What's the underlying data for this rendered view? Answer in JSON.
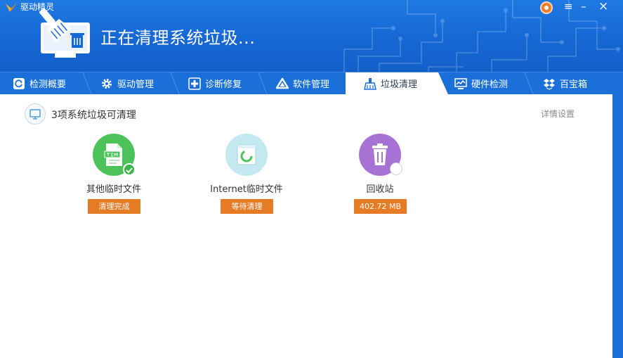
{
  "app": {
    "title": "驱动精灵",
    "status_text": "正在清理系统垃圾..."
  },
  "window_controls": {
    "menu": "≡",
    "minimize": "–",
    "close": "×"
  },
  "tabs": [
    {
      "label": "检测概要",
      "icon": "refresh-icon",
      "active": false
    },
    {
      "label": "驱动管理",
      "icon": "gear-icon",
      "active": false
    },
    {
      "label": "诊断修复",
      "icon": "medical-cross-icon",
      "active": false
    },
    {
      "label": "软件管理",
      "icon": "triangle-logo-icon",
      "active": false
    },
    {
      "label": "垃圾清理",
      "icon": "broom-icon",
      "active": true
    },
    {
      "label": "硬件检测",
      "icon": "monitor-chart-icon",
      "active": false
    },
    {
      "label": "百宝箱",
      "icon": "dropbox-icon",
      "active": false
    }
  ],
  "cleanup": {
    "summary": "3项系统垃圾可清理",
    "settings_link": "详情设置",
    "items": [
      {
        "label": "其他临时文件",
        "status": "清理完成",
        "icon": "temp-file-icon",
        "color": "#4cc35a"
      },
      {
        "label": "Internet临时文件",
        "status": "等待清理",
        "icon": "browser-cache-icon",
        "color": "#c4e8f0"
      },
      {
        "label": "回收站",
        "status": "402.72 MB",
        "icon": "trash-icon",
        "color": "#a871d4"
      }
    ]
  },
  "colors": {
    "header_blue": "#1a6fd8",
    "badge_orange": "#e57b25",
    "done_green": "#3ab54a"
  }
}
